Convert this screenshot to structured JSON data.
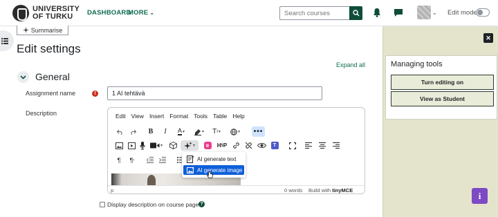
{
  "navbar": {
    "logo_line1": "UNIVERSITY",
    "logo_line2": "OF TURKU",
    "dashboard_label": "DASHBOARD",
    "more_label": "MORE",
    "search_placeholder": "Search courses",
    "edit_mode_label": "Edit mode"
  },
  "page": {
    "summarise_label": "Summarise",
    "title": "Edit settings",
    "expand_all": "Expand all"
  },
  "general": {
    "section_title": "General",
    "assignment_name_label": "Assignment name",
    "assignment_name_value": "1 AI tehtävä",
    "description_label": "Description",
    "display_description_label": "Display description on course page"
  },
  "editor": {
    "menu": [
      "Edit",
      "View",
      "Insert",
      "Format",
      "Tools",
      "Table",
      "Help"
    ],
    "status_path": "p",
    "word_count": "0 words",
    "build_with": "Build with",
    "brand": "tinyMCE",
    "dropdown": {
      "item1": "AI generate text",
      "item2": "AI generate image"
    }
  },
  "drawer": {
    "title": "Managing tools",
    "turn_editing_on": "Turn editing on",
    "view_as_student": "View as Student"
  },
  "colors": {
    "brand_green": "#0f4c3a",
    "drawer_bg": "#e4e4cc",
    "selection_blue": "#0e5fd8",
    "info_purple": "#7e49c4"
  },
  "icons": [
    "search-icon",
    "bell-icon",
    "chat-icon",
    "chevron-down-icon",
    "hamburger-icon",
    "sparkle-icon",
    "ai-icon",
    "close-icon",
    "help-icon",
    "info-icon",
    "error-icon"
  ]
}
